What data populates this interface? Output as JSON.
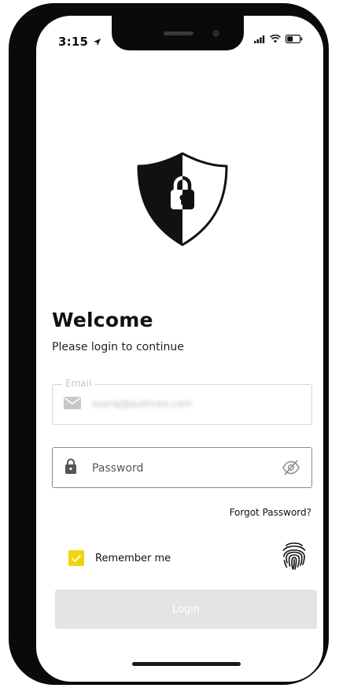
{
  "status_bar": {
    "time": "3:15",
    "location_icon": "location-arrow-icon",
    "signal_icon": "cellular-signal-icon",
    "wifi_icon": "wifi-icon",
    "battery_icon": "battery-icon"
  },
  "logo": {
    "icon": "shield-lock-icon"
  },
  "heading": {
    "title": "Welcome",
    "subtitle": "Please login to continue"
  },
  "form": {
    "email": {
      "label": "Email",
      "value": "sooraj@authnex.com",
      "icon": "envelope-icon"
    },
    "password": {
      "placeholder": "Password",
      "icon": "padlock-icon",
      "toggle_icon": "eye-off-icon"
    },
    "forgot_password": "Forgot Password?",
    "remember_me": {
      "label": "Remember me",
      "checked": true
    },
    "biometric_icon": "fingerprint-icon",
    "login_label": "Login"
  },
  "colors": {
    "accent": "#f5d20e",
    "button_disabled": "#e4e4e4",
    "text_primary": "#111111"
  }
}
